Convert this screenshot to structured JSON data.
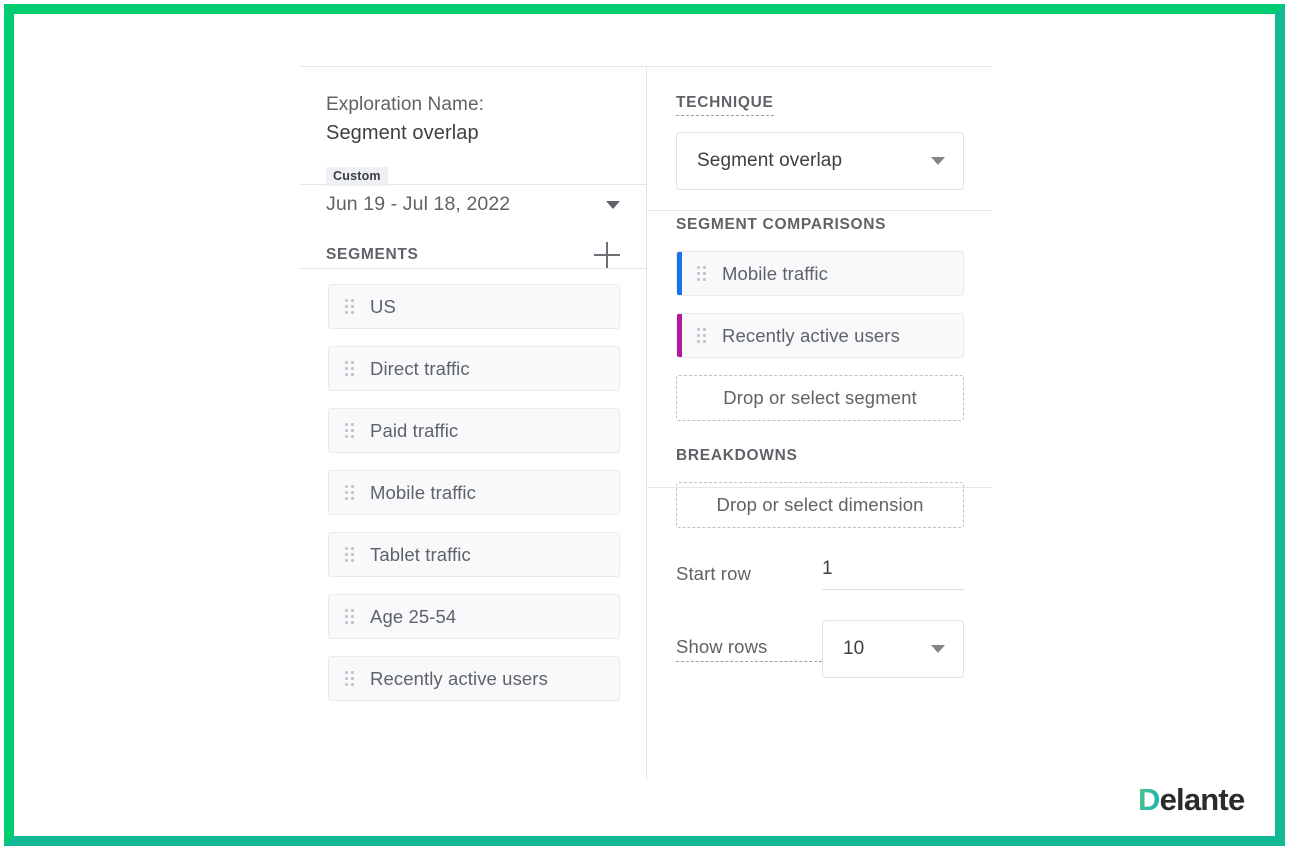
{
  "theme": {
    "frame_color_top": "#00cc70",
    "frame_color_bottom": "#11b894",
    "chip_background": "#f8f9fa",
    "text_primary": "#3c4043",
    "text_secondary": "#5f6368"
  },
  "left_panel": {
    "exploration_label": "Exploration Name:",
    "exploration_name": "Segment overlap",
    "date_range": {
      "badge": "Custom",
      "value": "Jun 19 - Jul 18, 2022",
      "caret_icon": "chevron-down-icon"
    },
    "segments_section": {
      "title": "SEGMENTS",
      "add_icon": "plus-icon",
      "items": [
        {
          "label": "US",
          "handle_icon": "drag-handle-icon"
        },
        {
          "label": "Direct traffic",
          "handle_icon": "drag-handle-icon"
        },
        {
          "label": "Paid traffic",
          "handle_icon": "drag-handle-icon"
        },
        {
          "label": "Mobile traffic",
          "handle_icon": "drag-handle-icon"
        },
        {
          "label": "Tablet traffic",
          "handle_icon": "drag-handle-icon"
        },
        {
          "label": "Age 25-54",
          "handle_icon": "drag-handle-icon"
        },
        {
          "label": "Recently active users",
          "handle_icon": "drag-handle-icon"
        }
      ]
    }
  },
  "right_panel": {
    "technique_section": {
      "title": "TECHNIQUE",
      "selected": "Segment overlap",
      "caret_icon": "chevron-down-icon"
    },
    "segment_comparisons_section": {
      "title": "SEGMENT COMPARISONS",
      "items": [
        {
          "label": "Mobile traffic",
          "color": "#1a73e8",
          "handle_icon": "drag-handle-icon"
        },
        {
          "label": "Recently active users",
          "color": "#b5179e",
          "handle_icon": "drag-handle-icon"
        }
      ],
      "dropzone": "Drop or select segment"
    },
    "breakdowns_section": {
      "title": "BREAKDOWNS",
      "dropzone": "Drop or select dimension",
      "start_row": {
        "label": "Start row",
        "value": "1"
      },
      "show_rows": {
        "label": "Show rows",
        "value": "10",
        "caret_icon": "chevron-down-icon"
      }
    }
  },
  "logo": {
    "first_letter": "D",
    "rest": "elante"
  }
}
